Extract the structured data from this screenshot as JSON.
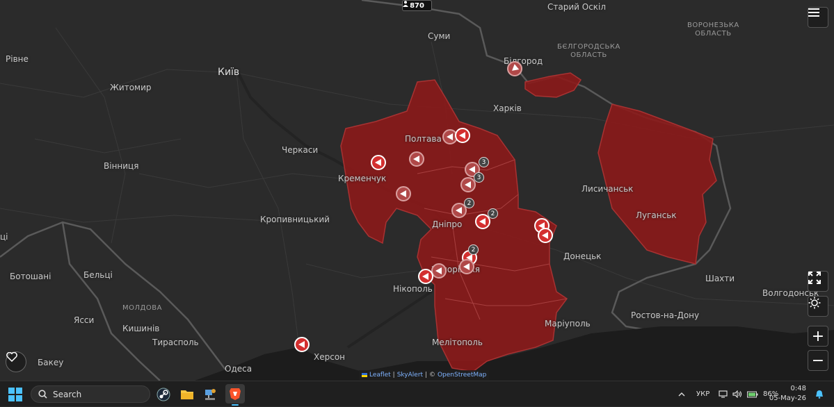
{
  "counter": {
    "icon": "person-icon",
    "value": "870"
  },
  "cities": {
    "kyiv": "Київ",
    "zhytomyr": "Житомир",
    "rivne": "Рівне",
    "sumy": "Суми",
    "stary_oskil": "Старий Оскіл",
    "bilgorod": "Білгород",
    "kharkiv": "Харків",
    "poltava": "Полтава",
    "cherkasy": "Черкаси",
    "vinnytsia": "Вінниця",
    "kremenchuk": "Кременчук",
    "kropyvnytskyi": "Кропивницький",
    "dnipro": "Дніпро",
    "lysychansk": "Лисичанськ",
    "luhansk": "Луганськ",
    "donetsk": "Донецьк",
    "shakhty": "Шахти",
    "volgodonsk": "Волгодонськ",
    "rostov": "Ростов-на-Дону",
    "mariupol": "Маріуполь",
    "melitopol": "Мелітополь",
    "nikopol": "Нікополь",
    "zaporizhzhia": "Запоріжжя",
    "kherson": "Херсон",
    "odesa": "Одеса",
    "botoshani": "Ботошані",
    "beltsi": "Бельці",
    "yassy": "Ясси",
    "kyshyniv": "Кишинів",
    "tiraspol": "Тирасполь",
    "bakeu": "Бакеу",
    "tsi": "ці"
  },
  "regions": {
    "voronezh": "ВОРОНЕЗЬКА\nОБЛАСТЬ",
    "belgorod": "БЄЛГОРОДСЬКА\nОБЛАСТЬ",
    "moldova": "МОЛДОВА"
  },
  "badges": [
    "3",
    "3",
    "2",
    "2",
    "2"
  ],
  "attribution": {
    "leaflet": "Leaflet",
    "sep1": "|",
    "skyalert": "SkyAlert",
    "sep2": "| ©",
    "osm": "OpenStreetMap"
  },
  "controls": {
    "menu_icon": "menu-icon",
    "fullscreen_icon": "fullscreen-icon",
    "theme_icon": "sun-icon",
    "zoom_in": "+",
    "zoom_out": "−",
    "heart_icon": "heart-icon"
  },
  "taskbar": {
    "search_placeholder": "Search",
    "language": "УКР",
    "battery": "86%",
    "time": "0:48",
    "date": "05-May-26"
  },
  "colors": {
    "alert_fill": "#8b1a1a",
    "marker": "#d32f2f",
    "accent": "#4cc2ff"
  }
}
